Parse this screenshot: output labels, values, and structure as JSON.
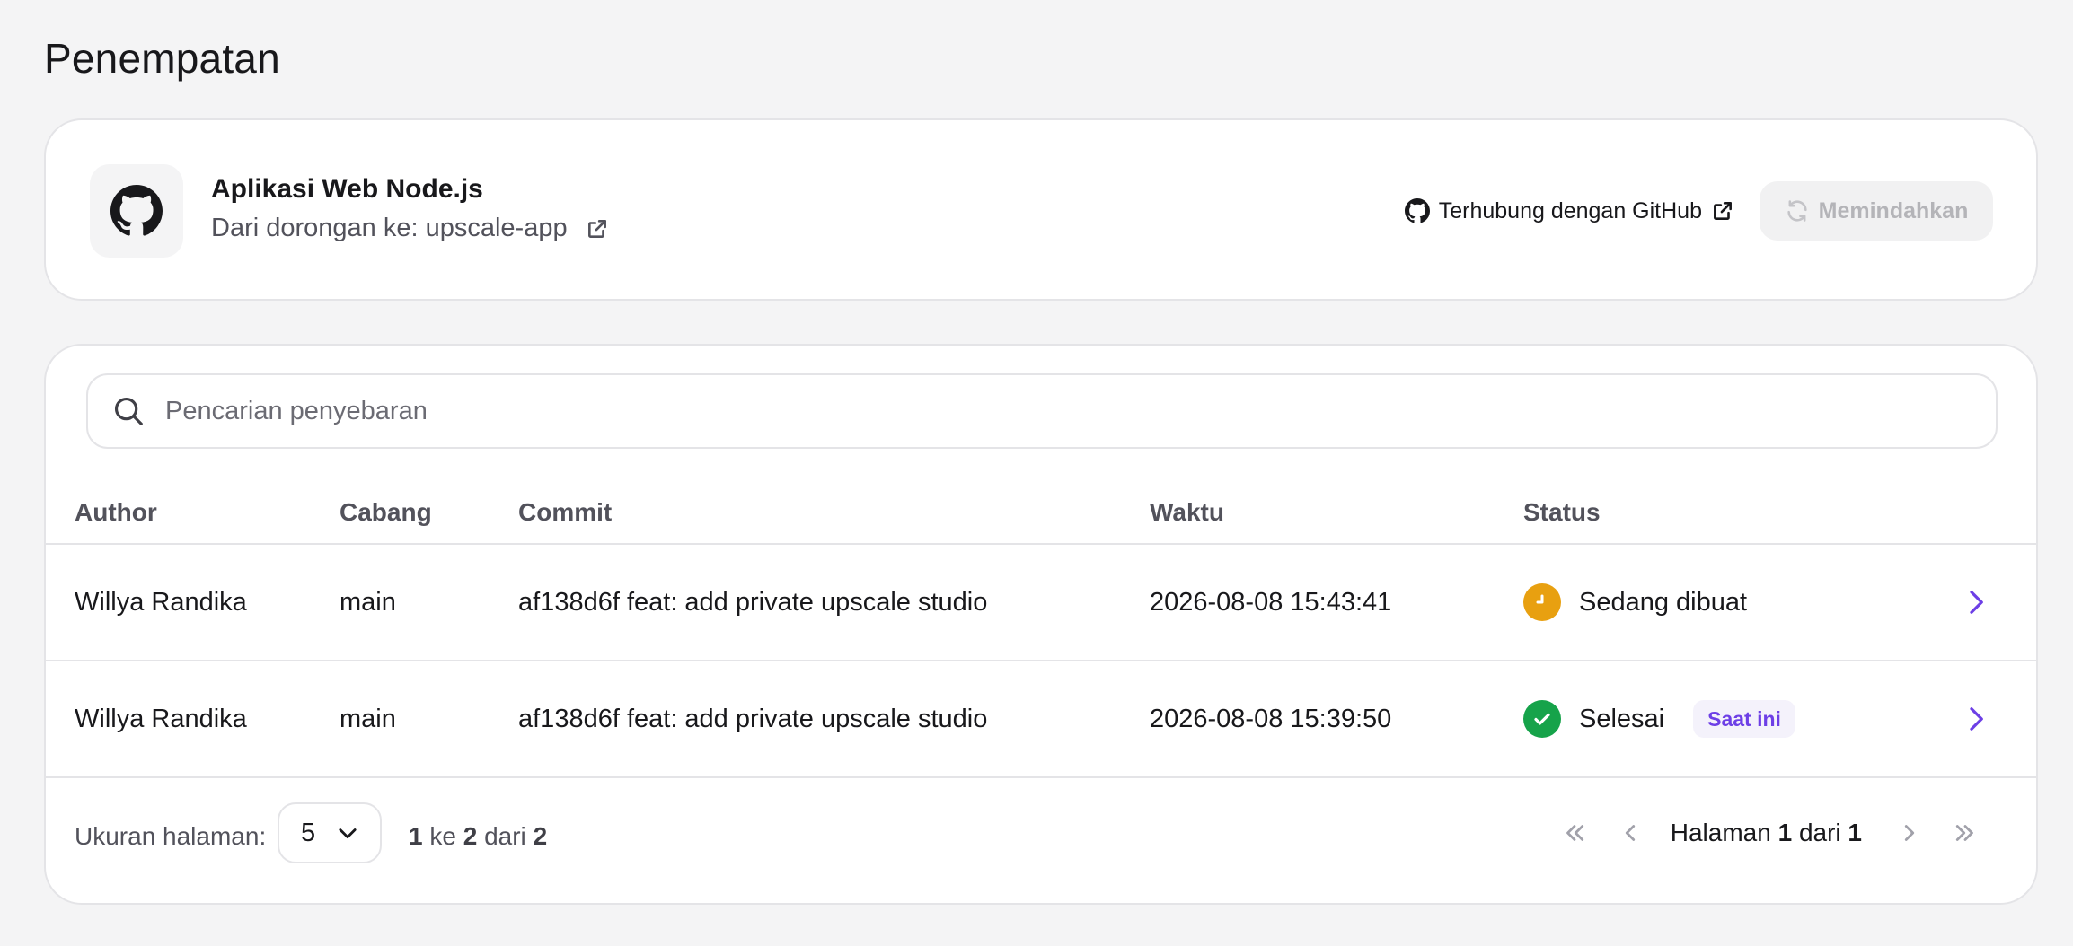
{
  "page": {
    "title": "Penempatan"
  },
  "repo": {
    "name": "Aplikasi Web Node.js",
    "source_prefix": "Dari dorongan ke:",
    "source_repo": "upscale-app",
    "github_link": "Terhubung dengan GitHub",
    "deploy_button": "Memindahkan"
  },
  "search": {
    "placeholder": "Pencarian penyebaran",
    "value": ""
  },
  "table": {
    "columns": [
      "Author",
      "Cabang",
      "Commit",
      "Waktu",
      "Status"
    ],
    "rows": [
      {
        "author": "Willya Randika",
        "branch": "main",
        "commit": "af138d6f feat: add private upscale studio",
        "time": "2026-08-08 15:43:41",
        "status": "Sedang dibuat",
        "status_icon": "clock-icon",
        "status_color": "#e8a010",
        "badge": ""
      },
      {
        "author": "Willya Randika",
        "branch": "main",
        "commit": "af138d6f feat: add private upscale studio",
        "time": "2026-08-08 15:39:50",
        "status": "Selesai",
        "status_icon": "check-icon",
        "status_color": "#16a34a",
        "badge": "Saat ini"
      }
    ]
  },
  "pagination": {
    "page_size_label": "Ukuran halaman:",
    "page_size": "5",
    "range_from": "1",
    "range_to_word": "ke",
    "range_to": "2",
    "range_of_word": "dari",
    "range_total": "2",
    "page_word": "Halaman",
    "current_page": "1",
    "of_word": "dari",
    "total_pages": "1"
  },
  "colors": {
    "accent": "#6d3fe6",
    "background": "#f4f4f5",
    "border": "#e4e4e7"
  }
}
